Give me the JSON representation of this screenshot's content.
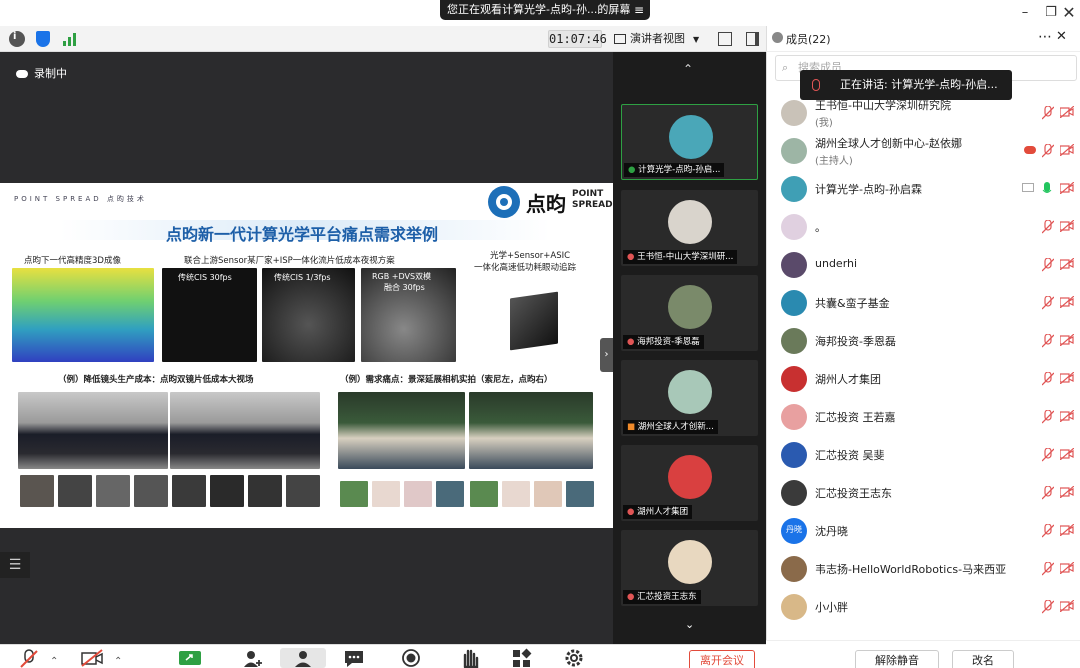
{
  "window": {
    "banner": "您正在观看计算光学-点昀-孙...的屏幕",
    "banner_menu_icon": "menu-icon",
    "minimize_icon": "minimize-icon",
    "restore_icon": "restore-icon",
    "close_icon": "close-icon"
  },
  "toolbar": {
    "info_icon": "info-icon",
    "security_icon": "shield-icon",
    "signal_icon": "signal-icon",
    "timer": "01:07:46",
    "view_label": "演讲者视图",
    "fullscreen_icon": "fullscreen-icon",
    "panel_icon": "panel-toggle-icon"
  },
  "share": {
    "recording_label": "录制中",
    "slide": {
      "brand_left": "POINT  SPREAD 点昀技术",
      "brand_right_cn": "点昀",
      "brand_right_en1": "POINT",
      "brand_right_en2": "SPREAD",
      "title": "点昀新一代计算光学平台痛点需求举例",
      "sec1": "点昀下一代高精度3D成像",
      "sec2": "联合上游Sensor某厂家+ISP一体化流片低成本夜视方案",
      "sec3_line1": "光学+Sensor+ASIC",
      "sec3_line2": "一体化高速低功耗眼动追踪",
      "cap1": "传统CIS 30fps",
      "cap2": "传统CIS 1/3fps",
      "cap3_line1": "RGB +DVS双模",
      "cap3_line2": "融合 30fps",
      "sec4": "（例）降低镜头生产成本：点昀双镜片低成本大视场",
      "sec5": "（例）需求痛点：景深延展相机实拍（索尼左，点昀右）"
    }
  },
  "strip": {
    "up_icon": "chevron-up-icon",
    "down_icon": "chevron-down-icon",
    "tiles": [
      {
        "label": "计算光学-点昀-孙启...",
        "color": "#4aa7b8"
      },
      {
        "label": "王书恒-中山大学深圳研...",
        "color": "#d9d4cc"
      },
      {
        "label": "海邦投资-季恩磊",
        "color": "#7a8a6a"
      },
      {
        "label": "湖州全球人才创新...",
        "color": "#a8c8b8"
      },
      {
        "label": "湖州人才集团",
        "color": "#d94040"
      },
      {
        "label": "汇芯投资王志东",
        "color": "#e8d8c0"
      }
    ]
  },
  "panel": {
    "title": "成员(22)",
    "more_icon": "more-icon",
    "close_icon": "close-icon",
    "search_placeholder": "搜索成员",
    "speaking_tooltip": "正在讲话: 计算光学-点昀-孙启...",
    "members": [
      {
        "name": "王书恒-中山大学深圳研究院",
        "role": "(我)",
        "avatar": "#c9c2b8"
      },
      {
        "name": "湖州全球人才创新中心-赵依娜",
        "role": "(主持人)",
        "avatar": "#9db5a5"
      },
      {
        "name": "计算光学-点昀-孙启霖",
        "role": "",
        "avatar": "#3f9fb5"
      },
      {
        "name": "。",
        "role": "",
        "avatar": "#e0d0e0"
      },
      {
        "name": "underhi",
        "role": "",
        "avatar": "#5a4a6a"
      },
      {
        "name": "共囊&蛮子基金",
        "role": "",
        "avatar": "#2a8ab0"
      },
      {
        "name": "海邦投资-季恩磊",
        "role": "",
        "avatar": "#6a7a5a"
      },
      {
        "name": "湖州人才集团",
        "role": "",
        "avatar": "#c83030"
      },
      {
        "name": "汇芯投资 王若嘉",
        "role": "",
        "avatar": "#e8a0a0"
      },
      {
        "name": "汇芯投资 吴斐",
        "role": "",
        "avatar": "#2a5ab0"
      },
      {
        "name": "汇芯投资王志东",
        "role": "",
        "avatar": "#3a3a3a"
      },
      {
        "name": "沈丹晓",
        "role": "",
        "avatar": "#1a73e8",
        "initials": "丹晓"
      },
      {
        "name": "韦志扬-HelloWorldRobotics-马来西亚",
        "role": "",
        "avatar": "#8a6a4a"
      },
      {
        "name": "小小胖",
        "role": "",
        "avatar": "#d8b888"
      }
    ],
    "unmute_all": "解除静音",
    "rename": "改名"
  },
  "bottom": {
    "leave": "离开会议"
  },
  "colors": {
    "accent": "#1a73e8",
    "danger": "#e24b3b",
    "muted_mic": "#e05555",
    "active_mic": "#22c55e"
  }
}
